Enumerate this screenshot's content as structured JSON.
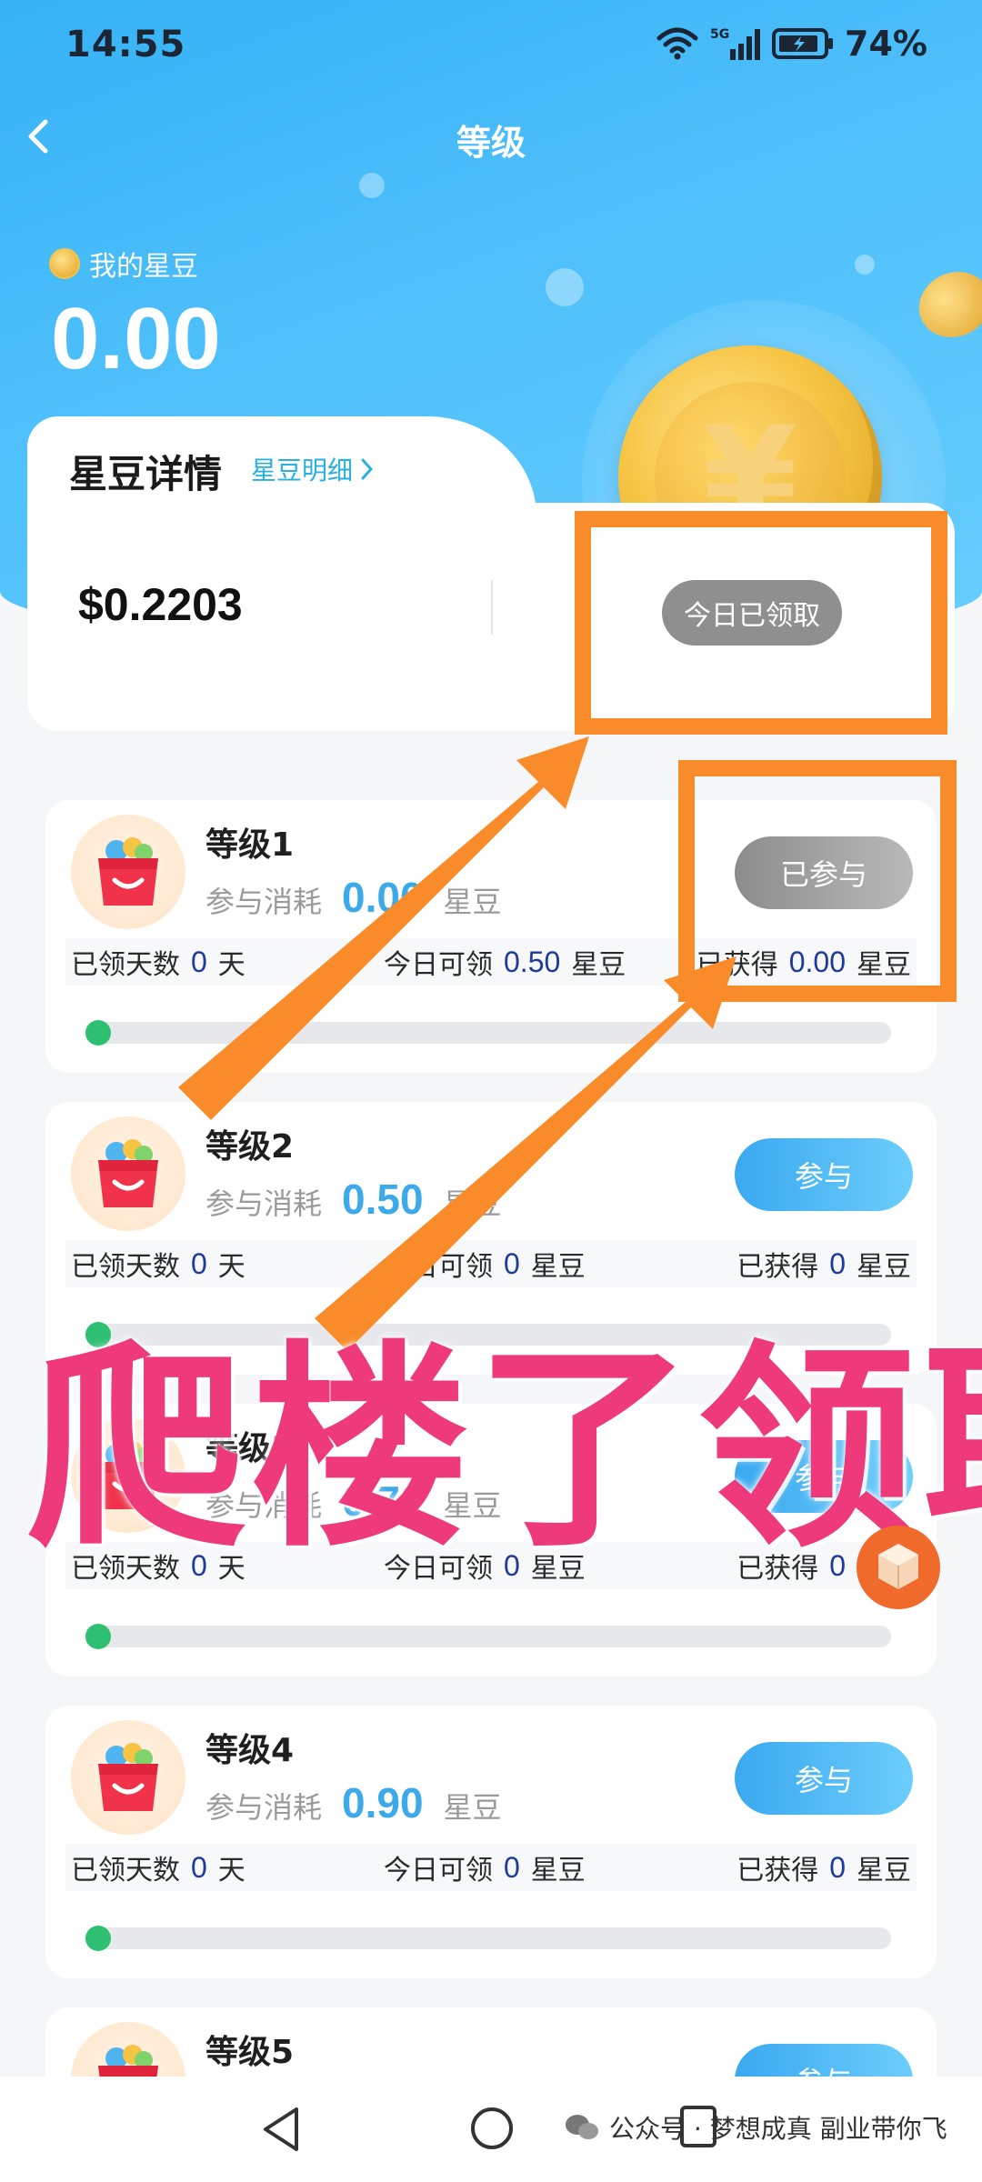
{
  "status_bar": {
    "time": "14:55",
    "network": "5G",
    "battery": "74%"
  },
  "nav": {
    "title": "等级"
  },
  "balance": {
    "label": "我的星豆",
    "value": "0.00"
  },
  "details": {
    "title": "星豆详情",
    "link": "星豆明细",
    "amount": "$0.2203",
    "claim_button": "今日已领取"
  },
  "stat_labels": {
    "claimed_days": "已领天数",
    "days_unit": "天",
    "today": "今日可领",
    "earned": "已获得",
    "unit": "星豆",
    "cost": "参与消耗"
  },
  "levels": [
    {
      "name": "等级1",
      "cost": "0.00",
      "button": "已参与",
      "state": "joined",
      "claimed_days": "0",
      "today": "0.50",
      "earned": "0.00",
      "progress": 0
    },
    {
      "name": "等级2",
      "cost": "0.50",
      "button": "参与",
      "state": "join",
      "claimed_days": "0",
      "today": "0",
      "earned": "0",
      "progress": 0
    },
    {
      "name": "等级3",
      "cost": "0.70",
      "button": "参与",
      "state": "join",
      "claimed_days": "0",
      "today": "0",
      "earned": "0",
      "progress": 0
    },
    {
      "name": "等级4",
      "cost": "0.90",
      "button": "参与",
      "state": "join",
      "claimed_days": "0",
      "today": "0",
      "earned": "0",
      "progress": 0
    },
    {
      "name": "等级5",
      "cost": "",
      "button": "参与",
      "state": "join",
      "claimed_days": "",
      "today": "",
      "earned": "",
      "progress": 0
    }
  ],
  "overlay": {
    "caption": "爬楼了领取",
    "highlight_color": "#f98b2a",
    "caption_color": "#ee3a7a"
  },
  "watermark": {
    "text": "公众号 · 梦想成真 副业带你飞"
  },
  "colors": {
    "accent": "#36b2f5",
    "cost": "#3ba9ea",
    "progress": "#2fbf71",
    "joined": "#8f8f8f"
  }
}
